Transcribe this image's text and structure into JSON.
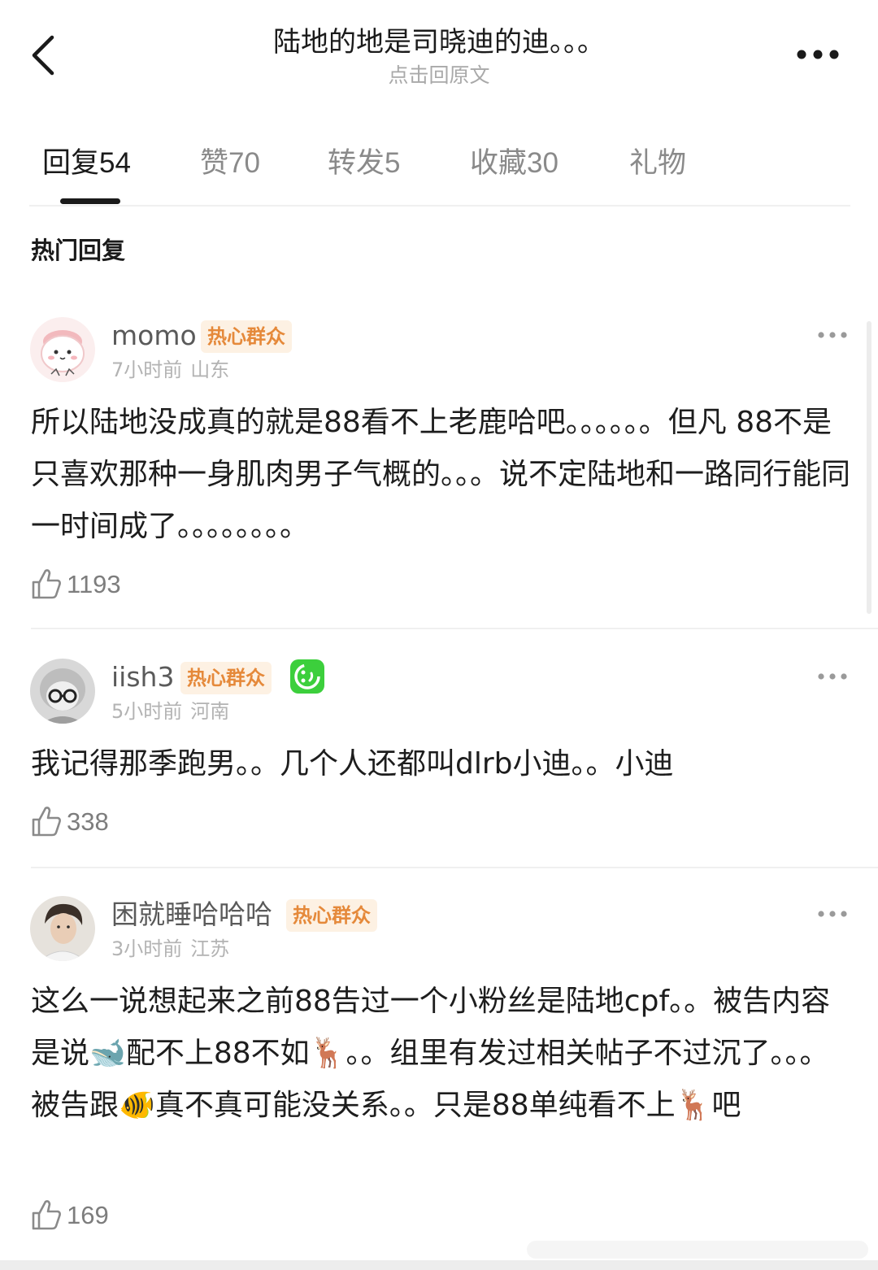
{
  "header": {
    "title": "陆地的地是司晓迪的迪。。。",
    "subtitle": "点击回原文"
  },
  "tabs": [
    {
      "label": "回复",
      "count": "54",
      "active": true
    },
    {
      "label": "赞",
      "count": "70",
      "active": false
    },
    {
      "label": "转发",
      "count": "5",
      "active": false
    },
    {
      "label": "收藏",
      "count": "30",
      "active": false
    },
    {
      "label": "礼物",
      "count": "",
      "active": false
    }
  ],
  "section_title": "热门回复",
  "comments": [
    {
      "username": "momo",
      "badge": "热心群众",
      "time": "7小时前",
      "location": "山东",
      "text": "所以陆地没成真的就是88看不上老鹿哈吧。。。。。。但凡 88不是只喜欢那种一身肌肉男子气概的。。。说不定陆地和一路同行能同一时间成了。。。。。。。。",
      "likes": "1193"
    },
    {
      "username": "iish3",
      "badge": "热心群众",
      "time": "5小时前",
      "location": "河南",
      "text": "我记得那季跑男。。几个人还都叫dlrb小迪。。小迪",
      "likes": "338"
    },
    {
      "username": "困就睡哈哈哈",
      "badge": "热心群众",
      "time": "3小时前",
      "location": "江苏",
      "text": "这么一说想起来之前88告过一个小粉丝是陆地cpf。。被告内容是说🐋配不上88不如🦌。。组里有发过相关帖子不过沉了。。。被告跟🐠真不真可能没关系。。只是88单纯看不上🦌吧",
      "likes": "169"
    }
  ],
  "colors": {
    "badge_text": "#e5893a",
    "badge_bg": "#fdf1e3",
    "vip_green": "#3ccf3c",
    "meta_gray": "#b3b3b3"
  },
  "icons": {
    "back": "chevron-left-icon",
    "more": "more-horizontal-icon",
    "like": "thumbs-up-icon",
    "vip": "green-smile-badge-icon"
  }
}
